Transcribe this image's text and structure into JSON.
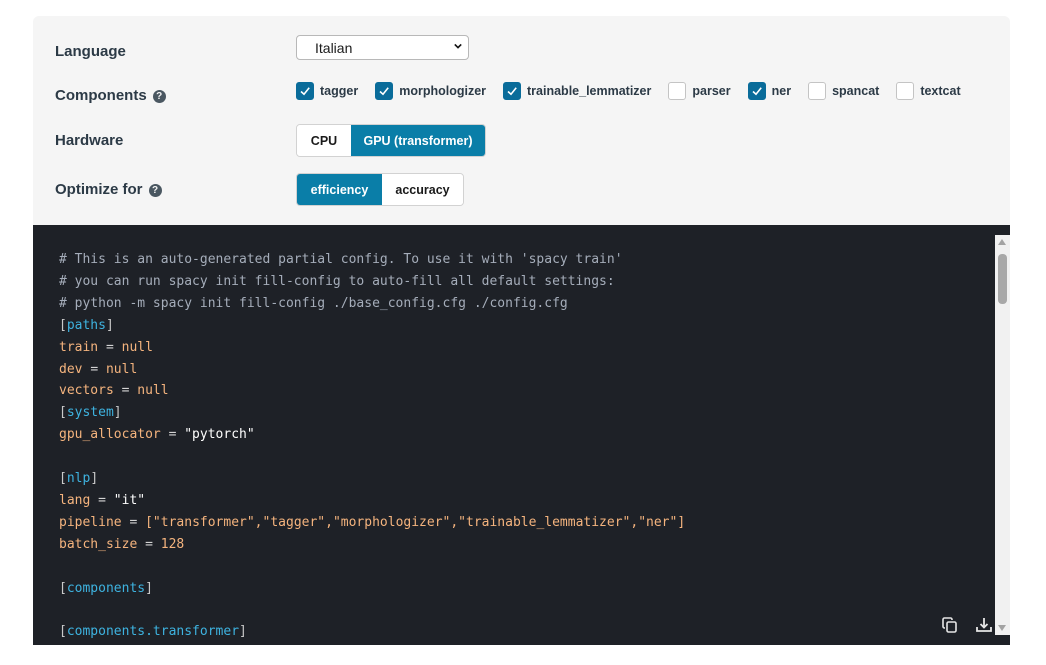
{
  "form": {
    "language": {
      "label": "Language",
      "selected": "Italian"
    },
    "components": {
      "label": "Components",
      "help": "?",
      "items": [
        {
          "label": "tagger",
          "checked": true
        },
        {
          "label": "morphologizer",
          "checked": true
        },
        {
          "label": "trainable_lemmatizer",
          "checked": true
        },
        {
          "label": "parser",
          "checked": false
        },
        {
          "label": "ner",
          "checked": true
        },
        {
          "label": "spancat",
          "checked": false
        },
        {
          "label": "textcat",
          "checked": false
        }
      ]
    },
    "hardware": {
      "label": "Hardware",
      "options": [
        "CPU",
        "GPU (transformer)"
      ],
      "selected": "GPU (transformer)"
    },
    "optimize": {
      "label": "Optimize for",
      "help": "?",
      "options": [
        "efficiency",
        "accuracy"
      ],
      "selected": "efficiency"
    }
  },
  "code": {
    "comments": [
      "# This is an auto-generated partial config. To use it with 'spacy train'",
      "# you can run spacy init fill-config to auto-fill all default settings:",
      "# python -m spacy init fill-config ./base_config.cfg ./config.cfg"
    ],
    "sections": {
      "paths": "paths",
      "system": "system",
      "nlp": "nlp",
      "components": "components",
      "components_transformer": "components.transformer"
    },
    "keys": {
      "train": "train",
      "dev": "dev",
      "vectors": "vectors",
      "gpu_allocator": "gpu_allocator",
      "lang": "lang",
      "pipeline": "pipeline",
      "batch_size": "batch_size"
    },
    "values": {
      "null": "null",
      "gpu_allocator": "\"pytorch\"",
      "lang": "\"it\"",
      "pipeline": "[\"transformer\",\"tagger\",\"morphologizer\",\"trainable_lemmatizer\",\"ner\"]",
      "batch_size": "128"
    },
    "equals": "="
  },
  "colors": {
    "accent": "#0a7ea8",
    "code_bg": "#1e2127",
    "panel_bg": "#f5f5f5"
  },
  "icons": {
    "copy": "copy-icon",
    "download": "download-icon"
  }
}
